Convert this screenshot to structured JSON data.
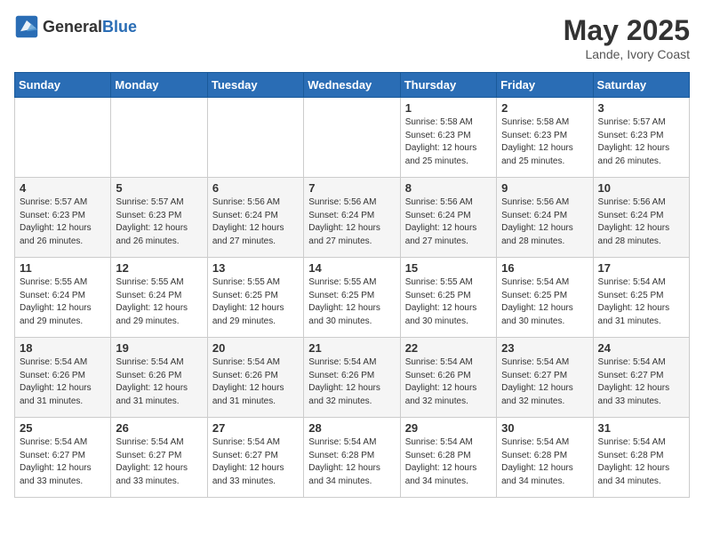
{
  "header": {
    "logo_general": "General",
    "logo_blue": "Blue",
    "title": "May 2025",
    "location": "Lande, Ivory Coast"
  },
  "weekdays": [
    "Sunday",
    "Monday",
    "Tuesday",
    "Wednesday",
    "Thursday",
    "Friday",
    "Saturday"
  ],
  "weeks": [
    [
      {
        "day": "",
        "info": ""
      },
      {
        "day": "",
        "info": ""
      },
      {
        "day": "",
        "info": ""
      },
      {
        "day": "",
        "info": ""
      },
      {
        "day": "1",
        "info": "Sunrise: 5:58 AM\nSunset: 6:23 PM\nDaylight: 12 hours\nand 25 minutes."
      },
      {
        "day": "2",
        "info": "Sunrise: 5:58 AM\nSunset: 6:23 PM\nDaylight: 12 hours\nand 25 minutes."
      },
      {
        "day": "3",
        "info": "Sunrise: 5:57 AM\nSunset: 6:23 PM\nDaylight: 12 hours\nand 26 minutes."
      }
    ],
    [
      {
        "day": "4",
        "info": "Sunrise: 5:57 AM\nSunset: 6:23 PM\nDaylight: 12 hours\nand 26 minutes."
      },
      {
        "day": "5",
        "info": "Sunrise: 5:57 AM\nSunset: 6:23 PM\nDaylight: 12 hours\nand 26 minutes."
      },
      {
        "day": "6",
        "info": "Sunrise: 5:56 AM\nSunset: 6:24 PM\nDaylight: 12 hours\nand 27 minutes."
      },
      {
        "day": "7",
        "info": "Sunrise: 5:56 AM\nSunset: 6:24 PM\nDaylight: 12 hours\nand 27 minutes."
      },
      {
        "day": "8",
        "info": "Sunrise: 5:56 AM\nSunset: 6:24 PM\nDaylight: 12 hours\nand 27 minutes."
      },
      {
        "day": "9",
        "info": "Sunrise: 5:56 AM\nSunset: 6:24 PM\nDaylight: 12 hours\nand 28 minutes."
      },
      {
        "day": "10",
        "info": "Sunrise: 5:56 AM\nSunset: 6:24 PM\nDaylight: 12 hours\nand 28 minutes."
      }
    ],
    [
      {
        "day": "11",
        "info": "Sunrise: 5:55 AM\nSunset: 6:24 PM\nDaylight: 12 hours\nand 29 minutes."
      },
      {
        "day": "12",
        "info": "Sunrise: 5:55 AM\nSunset: 6:24 PM\nDaylight: 12 hours\nand 29 minutes."
      },
      {
        "day": "13",
        "info": "Sunrise: 5:55 AM\nSunset: 6:25 PM\nDaylight: 12 hours\nand 29 minutes."
      },
      {
        "day": "14",
        "info": "Sunrise: 5:55 AM\nSunset: 6:25 PM\nDaylight: 12 hours\nand 30 minutes."
      },
      {
        "day": "15",
        "info": "Sunrise: 5:55 AM\nSunset: 6:25 PM\nDaylight: 12 hours\nand 30 minutes."
      },
      {
        "day": "16",
        "info": "Sunrise: 5:54 AM\nSunset: 6:25 PM\nDaylight: 12 hours\nand 30 minutes."
      },
      {
        "day": "17",
        "info": "Sunrise: 5:54 AM\nSunset: 6:25 PM\nDaylight: 12 hours\nand 31 minutes."
      }
    ],
    [
      {
        "day": "18",
        "info": "Sunrise: 5:54 AM\nSunset: 6:26 PM\nDaylight: 12 hours\nand 31 minutes."
      },
      {
        "day": "19",
        "info": "Sunrise: 5:54 AM\nSunset: 6:26 PM\nDaylight: 12 hours\nand 31 minutes."
      },
      {
        "day": "20",
        "info": "Sunrise: 5:54 AM\nSunset: 6:26 PM\nDaylight: 12 hours\nand 31 minutes."
      },
      {
        "day": "21",
        "info": "Sunrise: 5:54 AM\nSunset: 6:26 PM\nDaylight: 12 hours\nand 32 minutes."
      },
      {
        "day": "22",
        "info": "Sunrise: 5:54 AM\nSunset: 6:26 PM\nDaylight: 12 hours\nand 32 minutes."
      },
      {
        "day": "23",
        "info": "Sunrise: 5:54 AM\nSunset: 6:27 PM\nDaylight: 12 hours\nand 32 minutes."
      },
      {
        "day": "24",
        "info": "Sunrise: 5:54 AM\nSunset: 6:27 PM\nDaylight: 12 hours\nand 33 minutes."
      }
    ],
    [
      {
        "day": "25",
        "info": "Sunrise: 5:54 AM\nSunset: 6:27 PM\nDaylight: 12 hours\nand 33 minutes."
      },
      {
        "day": "26",
        "info": "Sunrise: 5:54 AM\nSunset: 6:27 PM\nDaylight: 12 hours\nand 33 minutes."
      },
      {
        "day": "27",
        "info": "Sunrise: 5:54 AM\nSunset: 6:27 PM\nDaylight: 12 hours\nand 33 minutes."
      },
      {
        "day": "28",
        "info": "Sunrise: 5:54 AM\nSunset: 6:28 PM\nDaylight: 12 hours\nand 34 minutes."
      },
      {
        "day": "29",
        "info": "Sunrise: 5:54 AM\nSunset: 6:28 PM\nDaylight: 12 hours\nand 34 minutes."
      },
      {
        "day": "30",
        "info": "Sunrise: 5:54 AM\nSunset: 6:28 PM\nDaylight: 12 hours\nand 34 minutes."
      },
      {
        "day": "31",
        "info": "Sunrise: 5:54 AM\nSunset: 6:28 PM\nDaylight: 12 hours\nand 34 minutes."
      }
    ]
  ]
}
